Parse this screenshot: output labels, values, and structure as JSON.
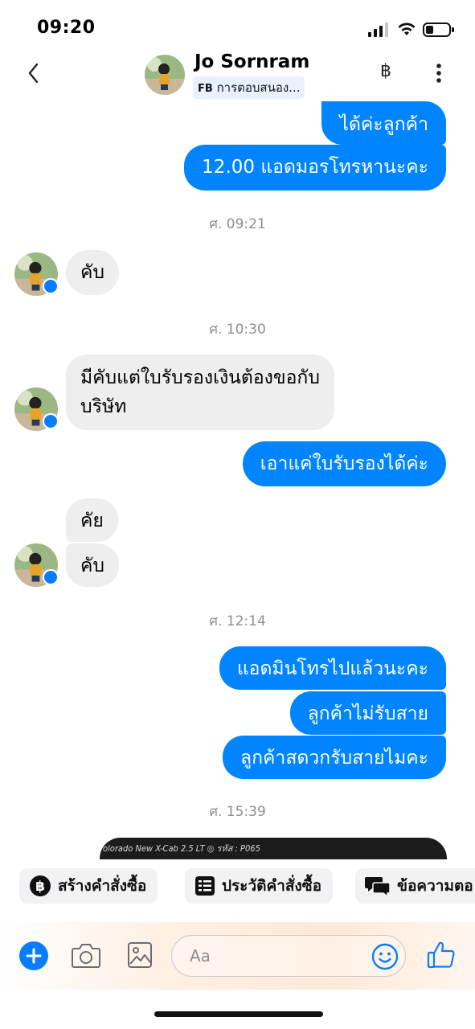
{
  "status_bar": {
    "time": "09:20"
  },
  "header": {
    "contact_name": "Jo Sornram",
    "source_tag": "FB",
    "source_text": "การตอบสนอง...",
    "baht_symbol": "฿"
  },
  "messages": [
    {
      "direction": "outgoing",
      "text": "ได้ค่ะลูกค้า"
    },
    {
      "direction": "outgoing",
      "text": "12.00 แอดมอรโทรหานะคะ"
    },
    {
      "type": "timestamp",
      "text": "ศ. 09:21"
    },
    {
      "direction": "incoming",
      "text": "คับ"
    },
    {
      "type": "timestamp",
      "text": "ศ. 10:30"
    },
    {
      "direction": "incoming",
      "text": "มีคับแต่ใบรับรองเงินต้องขอกับ",
      "text_line2": "บริษัท"
    },
    {
      "direction": "outgoing",
      "text": "เอาแค่ใบรับรองได้ค่ะ"
    },
    {
      "direction": "incoming",
      "text": "คัย"
    },
    {
      "direction": "incoming",
      "text": "คับ"
    },
    {
      "type": "timestamp",
      "text": "ศ. 12:14"
    },
    {
      "direction": "outgoing",
      "text": "แอดมินโทรไปแล้วนะคะ"
    },
    {
      "direction": "outgoing",
      "text": "ลูกค้าไม่รับสาย"
    },
    {
      "direction": "outgoing",
      "text": "ลูกค้าสดวกรับสายไมคะ"
    },
    {
      "type": "timestamp",
      "text": "ศ. 15:39"
    },
    {
      "direction": "outgoing",
      "type": "image-preview",
      "caption": "olorado New X-Cab 2.5 LT ◎ รหัส : P065"
    }
  ],
  "quick_actions": [
    {
      "label": "สร้างคำสั่งซื้อ",
      "icon": "baht-circle-icon"
    },
    {
      "label": "ประวัติคำสั่งซื้อ",
      "icon": "list-icon"
    },
    {
      "label": "ข้อความตอ",
      "icon": "chat-bubbles-icon"
    }
  ],
  "composer": {
    "placeholder": "Aa"
  },
  "colors": {
    "outgoing_bubble": "#0084ff",
    "incoming_bubble": "#eeeeee",
    "accent": "#0a7cff",
    "timestamp": "#8e8e93"
  }
}
